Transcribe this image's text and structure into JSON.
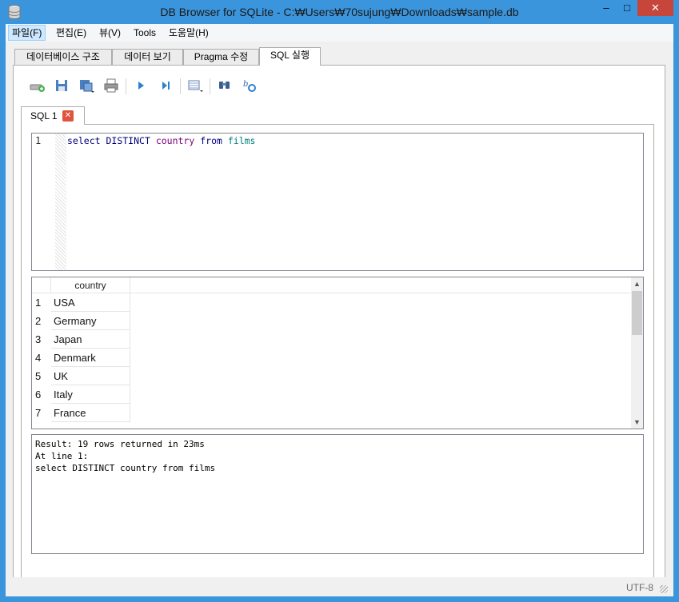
{
  "window": {
    "title": "DB Browser for SQLite - C:₩Users₩70sujung₩Downloads₩sample.db",
    "minimize_glyph": "–",
    "maximize_glyph": "□",
    "close_glyph": "✕"
  },
  "menu": [
    "파일(F)",
    "편집(E)",
    "뷰(V)",
    "Tools",
    "도움말(H)"
  ],
  "tabs": [
    "데이터베이스 구조",
    "데이터 보기",
    "Pragma 수정",
    "SQL 실행"
  ],
  "toolbar_icons": [
    "open-tab-icon",
    "open-sql-file-icon",
    "save-sql-file-icon",
    "print-icon",
    "execute-all-icon",
    "execute-line-icon",
    "save-results-icon",
    "find-icon",
    "find-replace-icon"
  ],
  "sql_tab": {
    "label": "SQL 1",
    "close_glyph": "✕"
  },
  "editor": {
    "line_number": "1",
    "tokens": [
      "select",
      "DISTINCT",
      "country",
      "from",
      "films"
    ]
  },
  "results": {
    "column_header": "country",
    "rows": [
      {
        "n": "1",
        "v": "USA"
      },
      {
        "n": "2",
        "v": "Germany"
      },
      {
        "n": "3",
        "v": "Japan"
      },
      {
        "n": "4",
        "v": "Denmark"
      },
      {
        "n": "5",
        "v": "UK"
      },
      {
        "n": "6",
        "v": "Italy"
      },
      {
        "n": "7",
        "v": "France"
      }
    ]
  },
  "messages": [
    "Result: 19 rows returned in 23ms",
    "At line 1:",
    "select DISTINCT country from films"
  ],
  "status": {
    "encoding": "UTF-8"
  },
  "colors": {
    "titlebar": "#3b95dc",
    "close_button": "#c7463c",
    "keyword": "#00007f",
    "keyword_alt": "#7a007a",
    "identifier": "#007f7f"
  }
}
